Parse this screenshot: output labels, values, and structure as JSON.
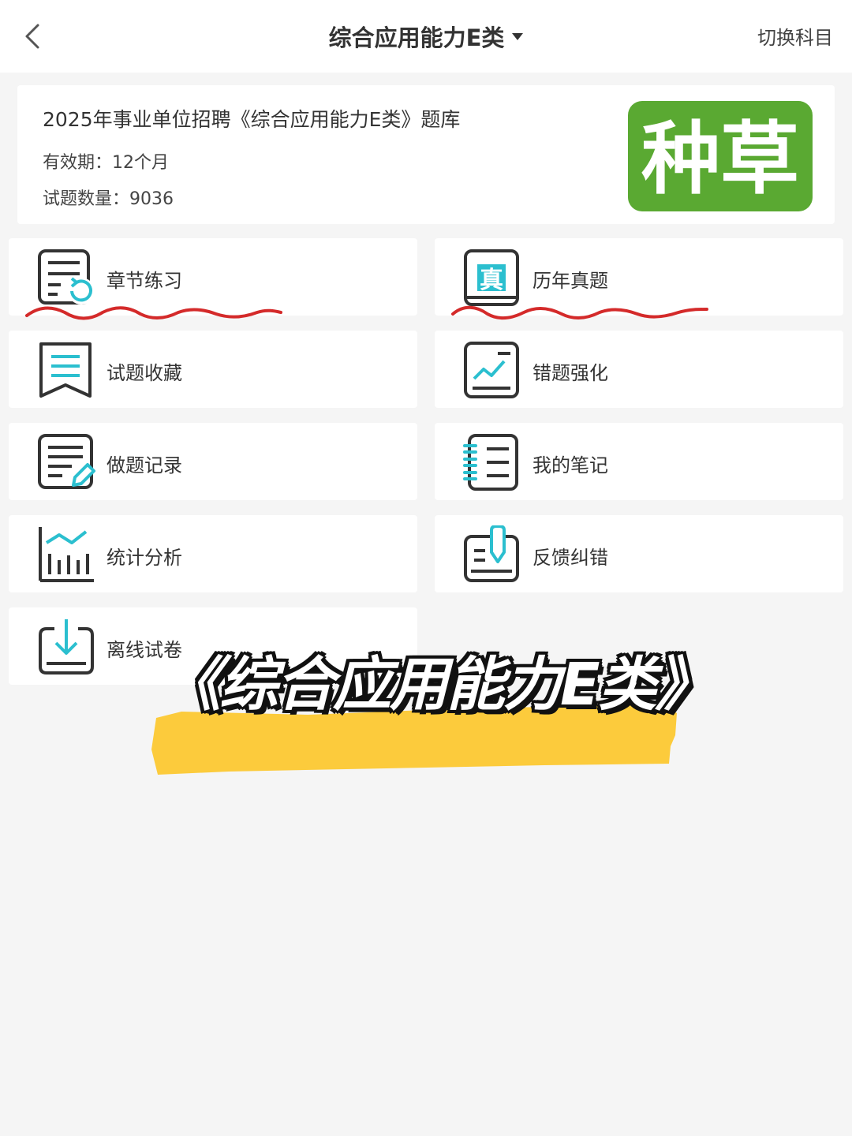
{
  "header": {
    "title": "综合应用能力E类",
    "switch_label": "切换科目"
  },
  "info": {
    "title": "2025年事业单位招聘《综合应用能力E类》题库",
    "validity": "有效期：12个月",
    "count": "试题数量：9036",
    "logo_text": "种草",
    "logo_color": "#5aa932"
  },
  "menu": {
    "chapter_practice": "章节练习",
    "past_exams": "历年真题",
    "favorites": "试题收藏",
    "mistakes": "错题强化",
    "records": "做题记录",
    "notes": "我的笔记",
    "statistics": "统计分析",
    "feedback": "反馈纠错",
    "offline": "离线试卷"
  },
  "overlay": {
    "caption": "《综合应用能力E类》"
  },
  "colors": {
    "accent": "#2bbfcf",
    "icon_dark": "#333333",
    "underline": "#d42a2a",
    "highlight": "#fccb3c"
  }
}
